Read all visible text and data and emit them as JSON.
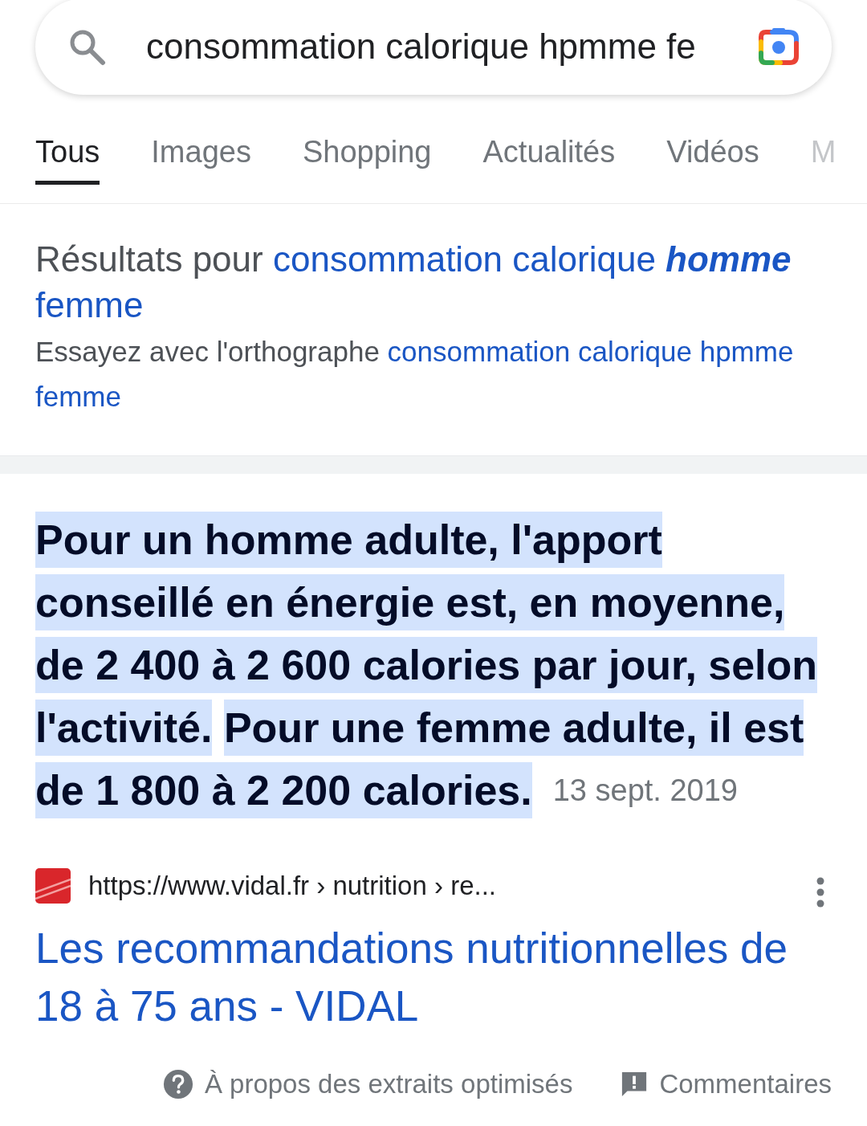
{
  "search": {
    "value": "consommation calorique hpmme fe"
  },
  "tabs": [
    {
      "label": "Tous",
      "selected": true
    },
    {
      "label": "Images",
      "selected": false
    },
    {
      "label": "Shopping",
      "selected": false
    },
    {
      "label": "Actualités",
      "selected": false
    },
    {
      "label": "Vidéos",
      "selected": false
    },
    {
      "label": "M",
      "selected": false
    }
  ],
  "correction": {
    "label": "Résultats pour",
    "query": "consommation calorique **homme** femme",
    "hint": "Essayez avec l'orthographe",
    "original_query": "consommation calorique hpmme femme"
  },
  "snippet": {
    "parts": [
      {
        "text": "Pour un homme adulte, l'apport conseillé en énergie est, en moyenne, de 2 400 à 2 600 calories par jour, selon l'activité.",
        "highlighted": true
      },
      {
        "text": "Pour une femme adulte, il est de 1 800 à 2 200 calories.",
        "highlighted": true
      }
    ],
    "date": "13 sept. 2019",
    "url": "https://www.vidal.fr › nutrition › re...",
    "title": "Les recommandations nutritionnelles de 18 à 75 ans - VIDAL"
  },
  "footer": [
    "À propos des extraits optimisés",
    "Commentaires"
  ]
}
